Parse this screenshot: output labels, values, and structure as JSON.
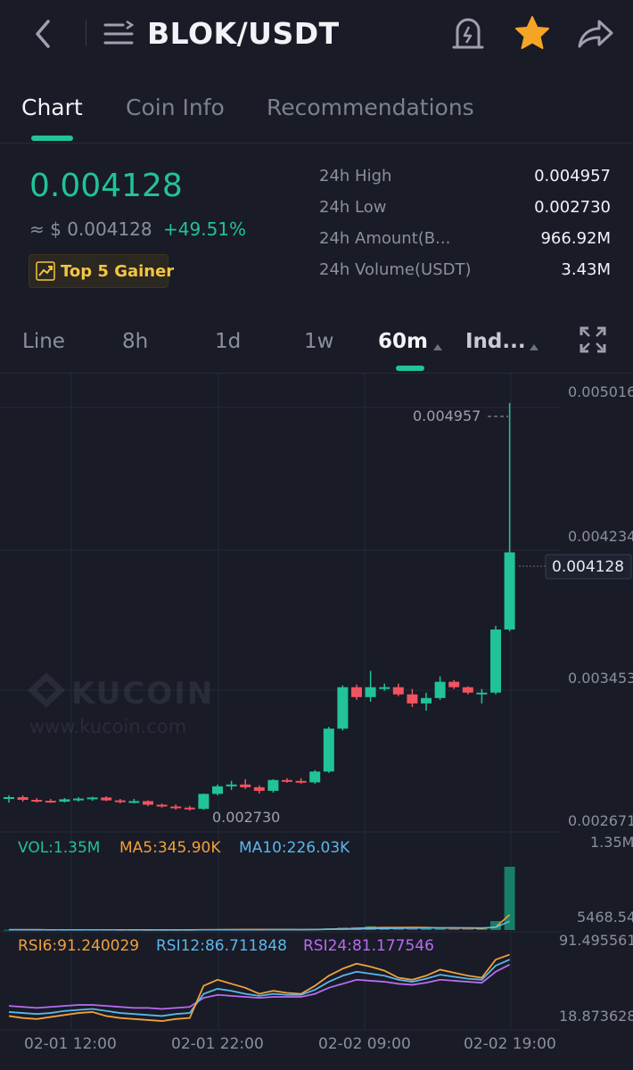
{
  "header": {
    "title": "BLOK/USDT"
  },
  "tabs": [
    {
      "label": "Chart"
    },
    {
      "label": "Coin Info"
    },
    {
      "label": "Recommendations"
    }
  ],
  "ticker": {
    "price": "0.004128",
    "usd_value": "≈ $ 0.004128",
    "change": "+49.51%",
    "badge": "Top 5 Gainer"
  },
  "stats": [
    {
      "label": "24h High",
      "value": "0.004957"
    },
    {
      "label": "24h Low",
      "value": "0.002730"
    },
    {
      "label": "24h Amount(B...",
      "value": "966.92M"
    },
    {
      "label": "24h Volume(USDT)",
      "value": "3.43M"
    }
  ],
  "timeframes": [
    {
      "label": "Line"
    },
    {
      "label": "8h"
    },
    {
      "label": "1d"
    },
    {
      "label": "1w"
    },
    {
      "label": "60m"
    },
    {
      "label": "Ind..."
    }
  ],
  "colors": {
    "up": "#21c397",
    "down": "#f1535f",
    "accent": "#21c397",
    "ma5": "#f0a13a",
    "ma10": "#5bb7ea",
    "rsi24": "#b86cf0"
  },
  "chart": {
    "price_axis": [
      "0.005016",
      "0.004234",
      "0.003453",
      "0.002671"
    ],
    "high_label": "0.004957",
    "low_label": "0.002730",
    "current_label": "0.004128",
    "watermark_brand": "KUCOIN",
    "watermark_url": "www.kucoin.com",
    "time_axis": [
      "02-01 12:00",
      "02-01 22:00",
      "02-02 09:00",
      "02-02 19:00"
    ]
  },
  "volume": {
    "vol": "VOL:1.35M",
    "ma5": "MA5:345.90K",
    "ma10": "MA10:226.03K",
    "axis_top": "1.35M",
    "axis_bottom": "5468.54"
  },
  "rsi": {
    "rsi6": "RSI6:91.240029",
    "rsi12": "RSI12:86.711848",
    "rsi24": "RSI24:81.177546",
    "axis_top": "91.495561",
    "axis_bottom": "18.873628"
  },
  "chart_data": {
    "type": "candlestick",
    "candles": [
      {
        "o": 0.00276,
        "h": 0.00278,
        "l": 0.00274,
        "c": 0.00277
      },
      {
        "o": 0.00277,
        "h": 0.00278,
        "l": 0.002745,
        "c": 0.002755
      },
      {
        "o": 0.002755,
        "h": 0.002765,
        "l": 0.00274,
        "c": 0.00275
      },
      {
        "o": 0.00275,
        "h": 0.00276,
        "l": 0.002738,
        "c": 0.002745
      },
      {
        "o": 0.002745,
        "h": 0.002765,
        "l": 0.00274,
        "c": 0.002758
      },
      {
        "o": 0.002758,
        "h": 0.00277,
        "l": 0.002745,
        "c": 0.002762
      },
      {
        "o": 0.002762,
        "h": 0.002772,
        "l": 0.00275,
        "c": 0.002768
      },
      {
        "o": 0.002768,
        "h": 0.002775,
        "l": 0.002748,
        "c": 0.002752
      },
      {
        "o": 0.002752,
        "h": 0.00276,
        "l": 0.002735,
        "c": 0.002742
      },
      {
        "o": 0.002742,
        "h": 0.00276,
        "l": 0.002735,
        "c": 0.002748
      },
      {
        "o": 0.002748,
        "h": 0.002752,
        "l": 0.00272,
        "c": 0.002728
      },
      {
        "o": 0.002728,
        "h": 0.002735,
        "l": 0.002712,
        "c": 0.002718
      },
      {
        "o": 0.002718,
        "h": 0.00273,
        "l": 0.0027,
        "c": 0.002712
      },
      {
        "o": 0.002712,
        "h": 0.002722,
        "l": 0.002695,
        "c": 0.002705
      },
      {
        "o": 0.002705,
        "h": 0.00279,
        "l": 0.0027,
        "c": 0.002788
      },
      {
        "o": 0.002788,
        "h": 0.00284,
        "l": 0.00278,
        "c": 0.00283
      },
      {
        "o": 0.00283,
        "h": 0.00286,
        "l": 0.00281,
        "c": 0.00284
      },
      {
        "o": 0.00284,
        "h": 0.00287,
        "l": 0.002815,
        "c": 0.002825
      },
      {
        "o": 0.002825,
        "h": 0.002835,
        "l": 0.00279,
        "c": 0.002805
      },
      {
        "o": 0.002805,
        "h": 0.00287,
        "l": 0.002795,
        "c": 0.002865
      },
      {
        "o": 0.002865,
        "h": 0.002875,
        "l": 0.00285,
        "c": 0.00286
      },
      {
        "o": 0.00286,
        "h": 0.002875,
        "l": 0.002845,
        "c": 0.002852
      },
      {
        "o": 0.002852,
        "h": 0.00292,
        "l": 0.002845,
        "c": 0.002912
      },
      {
        "o": 0.002912,
        "h": 0.00316,
        "l": 0.002905,
        "c": 0.00315
      },
      {
        "o": 0.00315,
        "h": 0.00339,
        "l": 0.00314,
        "c": 0.00338
      },
      {
        "o": 0.00338,
        "h": 0.003395,
        "l": 0.00331,
        "c": 0.003325
      },
      {
        "o": 0.003325,
        "h": 0.00347,
        "l": 0.0033,
        "c": 0.00338
      },
      {
        "o": 0.00338,
        "h": 0.0034,
        "l": 0.00336,
        "c": 0.00338
      },
      {
        "o": 0.00338,
        "h": 0.0034,
        "l": 0.00333,
        "c": 0.00334
      },
      {
        "o": 0.00334,
        "h": 0.00337,
        "l": 0.00327,
        "c": 0.00329
      },
      {
        "o": 0.00329,
        "h": 0.00335,
        "l": 0.00325,
        "c": 0.00332
      },
      {
        "o": 0.00332,
        "h": 0.00344,
        "l": 0.00331,
        "c": 0.00341
      },
      {
        "o": 0.00341,
        "h": 0.00342,
        "l": 0.00337,
        "c": 0.00338
      },
      {
        "o": 0.00338,
        "h": 0.003385,
        "l": 0.00334,
        "c": 0.00335
      },
      {
        "o": 0.00335,
        "h": 0.00337,
        "l": 0.00329,
        "c": 0.00335
      },
      {
        "o": 0.00335,
        "h": 0.00372,
        "l": 0.00334,
        "c": 0.0037
      },
      {
        "o": 0.0037,
        "h": 0.004957,
        "l": 0.00369,
        "c": 0.004128
      }
    ],
    "volume": [
      60,
      50,
      45,
      40,
      50,
      45,
      55,
      40,
      35,
      45,
      30,
      35,
      30,
      40,
      120,
      140,
      110,
      90,
      70,
      130,
      110,
      80,
      180,
      380,
      520,
      600,
      820,
      420,
      380,
      560,
      460,
      380,
      300,
      320,
      260,
      1900,
      13500
    ],
    "volume_ylim": [
      0,
      13500
    ],
    "rsi6": [
      30,
      28,
      27,
      29,
      31,
      33,
      34,
      30,
      28,
      27,
      26,
      25,
      27,
      28,
      60,
      66,
      62,
      58,
      52,
      55,
      53,
      52,
      60,
      70,
      77,
      82,
      79,
      75,
      68,
      66,
      70,
      76,
      73,
      70,
      68,
      86,
      91
    ],
    "rsi12": [
      34,
      33,
      32,
      33,
      35,
      36,
      37,
      35,
      33,
      32,
      31,
      30,
      32,
      33,
      52,
      57,
      55,
      52,
      50,
      52,
      51,
      51,
      56,
      64,
      70,
      74,
      72,
      70,
      66,
      64,
      67,
      71,
      69,
      67,
      66,
      80,
      86
    ],
    "rsi24": [
      40,
      39,
      38,
      39,
      40,
      41,
      41,
      40,
      39,
      38,
      38,
      37,
      38,
      39,
      48,
      51,
      50,
      49,
      48,
      49,
      49,
      49,
      52,
      58,
      62,
      66,
      65,
      64,
      62,
      61,
      63,
      66,
      65,
      64,
      63,
      74,
      81
    ],
    "rsi_ylim": [
      18.873628,
      91.495561
    ],
    "price_ylim": [
      0.002671,
      0.005016
    ]
  }
}
